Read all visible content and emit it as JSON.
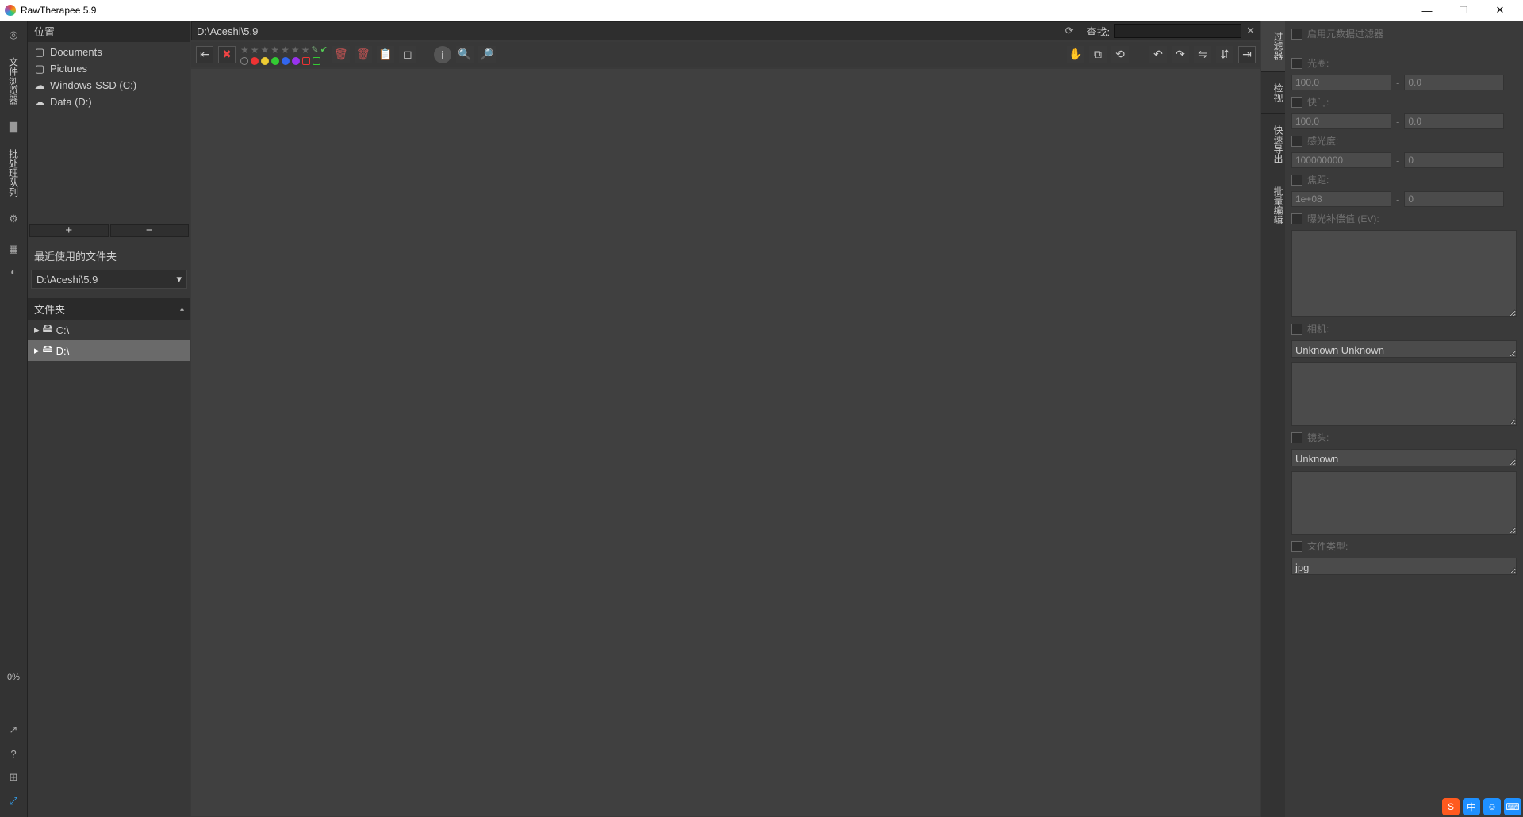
{
  "titlebar": {
    "title": "RawTherapee 5.9"
  },
  "leftrail": {
    "tab_browser": "文件浏览器",
    "tab_queue": "批处理队列",
    "progress": "0%"
  },
  "places": {
    "header": "位置",
    "items": [
      {
        "label": "Documents"
      },
      {
        "label": "Pictures"
      },
      {
        "label": "Windows-SSD (C:)"
      },
      {
        "label": "Data (D:)"
      }
    ]
  },
  "recent": {
    "header": "最近使用的文件夹",
    "value": "D:\\Aceshi\\5.9"
  },
  "folders": {
    "header": "文件夹",
    "items": [
      {
        "label": "C:\\"
      },
      {
        "label": "D:\\"
      }
    ]
  },
  "pathbar": {
    "path": "D:\\Aceshi\\5.9",
    "search_label": "查找:"
  },
  "righttabs": {
    "t1": "过滤器",
    "t2": "检视",
    "t3": "快速导出",
    "t4": "批量编辑"
  },
  "filter": {
    "enable_label": "启用元数据过滤器",
    "aperture_label": "光圈:",
    "aperture_from": "100.0",
    "aperture_to": "0.0",
    "shutter_label": "快门:",
    "shutter_from": "100.0",
    "shutter_to": "0.0",
    "iso_label": "感光度:",
    "iso_from": "100000000",
    "iso_to": "0",
    "focal_label": "焦距:",
    "focal_from": "1e+08",
    "focal_to": "0",
    "ev_label": "曝光补偿值 (EV):",
    "ev_text": "",
    "camera_label": "相机:",
    "camera_text": "Unknown Unknown",
    "lens_label": "镜头:",
    "lens_text": "Unknown",
    "filetype_label": "文件类型:",
    "filetype_text": "jpg"
  },
  "tray": {
    "ime": "中"
  }
}
